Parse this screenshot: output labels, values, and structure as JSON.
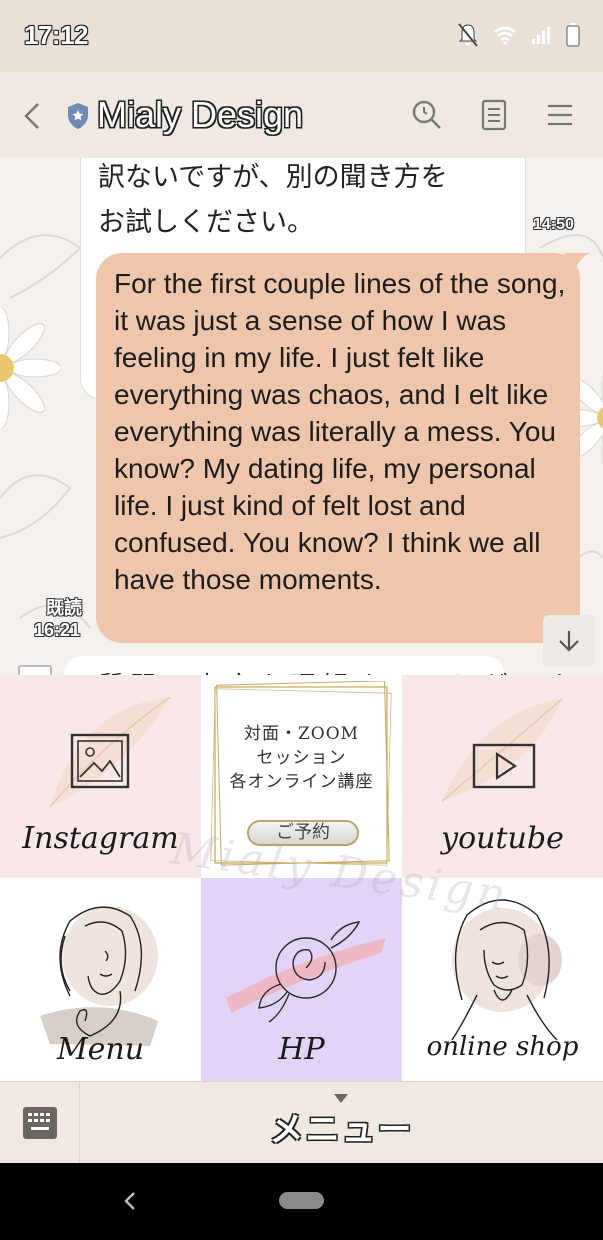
{
  "status_bar": {
    "time": "17:12",
    "icons": [
      "notifications-off-icon",
      "wifi-icon",
      "signal-icon",
      "battery-icon"
    ]
  },
  "header": {
    "title": "Mialy Design",
    "icons": [
      "back-icon",
      "shield-icon",
      "search-icon",
      "notes-icon",
      "menu-icon"
    ]
  },
  "messages": [
    {
      "direction": "incoming",
      "lines": [
        "訳ないですが、別の聞き方を",
        "お試しください。"
      ],
      "time": "14:50"
    },
    {
      "direction": "outgoing",
      "text": "For the first couple lines of the song, it was just a sense of how I was feeling in my life. I just felt like everything was chaos, and I elt like everything was literally a mess. You know? My dating life, my personal life. I just kind of felt lost and confused. You know? I think we all have those moments.",
      "read_label": "既読",
      "time": "16:21"
    },
    {
      "direction": "incoming",
      "partial_text": "質問の内容を理解することができ"
    }
  ],
  "rich_menu": {
    "tiles": [
      {
        "label": "Instagram",
        "icon": "image-icon",
        "bg": "#f8e9e8"
      },
      {
        "lines": [
          "対面・ZOOM",
          "セッション",
          "各オンライン講座"
        ],
        "button": "ご予約",
        "bg": "#ffffff"
      },
      {
        "label": "youtube",
        "icon": "play-icon",
        "bg": "#f8e9e8"
      },
      {
        "label": "Menu",
        "icon": "face-line-art-icon",
        "bg": "#ffffff"
      },
      {
        "label": "HP",
        "icon": "rose-icon",
        "bg": "#e2d4f6"
      },
      {
        "label": "online shop",
        "icon": "woman-line-art-icon",
        "bg": "#ffffff"
      }
    ],
    "watermark": "Mialy Design"
  },
  "menu_bar": {
    "label": "メニュー",
    "icons": [
      "keyboard-icon",
      "caret-down-icon"
    ]
  },
  "nav_bar": {
    "icons": [
      "nav-back-icon",
      "home-pill-icon"
    ]
  },
  "colors": {
    "outgoing_bubble": "#efc5ab",
    "header_bg": "#efe9e2",
    "hp_tile": "#e2d4f6",
    "pink_tile": "#f8e9e8"
  }
}
